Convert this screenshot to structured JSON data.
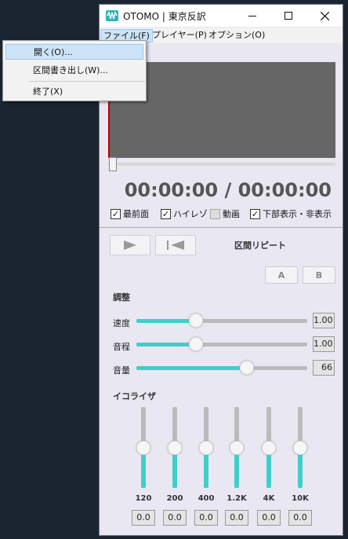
{
  "window": {
    "title": "OTOMO | 東京反訳",
    "controls": {
      "minimize": "—",
      "maximize": "☐",
      "close": "✕"
    }
  },
  "menubar": {
    "items": [
      {
        "label": "ファイル(F)",
        "active": true
      },
      {
        "label": "プレイヤー(P)",
        "active": false
      },
      {
        "label": "オプション(O)",
        "active": false
      }
    ]
  },
  "file_menu": {
    "items": [
      {
        "label": "開く(O)...",
        "highlighted": true
      },
      {
        "label": "区間書き出し(W)...",
        "highlighted": false
      },
      {
        "label": "終了(X)",
        "highlighted": false
      }
    ]
  },
  "player": {
    "time_display": "00:00:00 / 00:00:00",
    "seek_position": 0
  },
  "options": {
    "always_on_top": {
      "label": "最前面",
      "checked": true
    },
    "hi_res": {
      "label": "ハイレゾ",
      "checked": true
    },
    "video": {
      "label": "動画",
      "checked": false
    },
    "bottom_display": {
      "label": "下部表示・非表示",
      "checked": true
    }
  },
  "controls": {
    "play_icon": "play-icon",
    "rewind_icon": "skip-to-start-icon",
    "repeat_label": "区間リピート",
    "a_label": "A",
    "b_label": "B"
  },
  "adjust": {
    "heading": "調整",
    "speed": {
      "label": "速度",
      "value": "1.00",
      "fraction": 0.35
    },
    "pitch": {
      "label": "音程",
      "value": "1.00",
      "fraction": 0.35
    },
    "volume": {
      "label": "音量",
      "value": "66",
      "fraction": 0.66
    }
  },
  "equalizer": {
    "heading": "イコライザ",
    "bands": [
      {
        "freq": "120",
        "value": "0.0",
        "level": 0.5
      },
      {
        "freq": "200",
        "value": "0.0",
        "level": 0.5
      },
      {
        "freq": "400",
        "value": "0.0",
        "level": 0.5
      },
      {
        "freq": "1.2K",
        "value": "0.0",
        "level": 0.5
      },
      {
        "freq": "4K",
        "value": "0.0",
        "level": 0.5
      },
      {
        "freq": "10K",
        "value": "0.0",
        "level": 0.5
      }
    ]
  },
  "colors": {
    "accent": "#40cfc8",
    "background": "#1b2431",
    "window": "#e9e7f2"
  }
}
